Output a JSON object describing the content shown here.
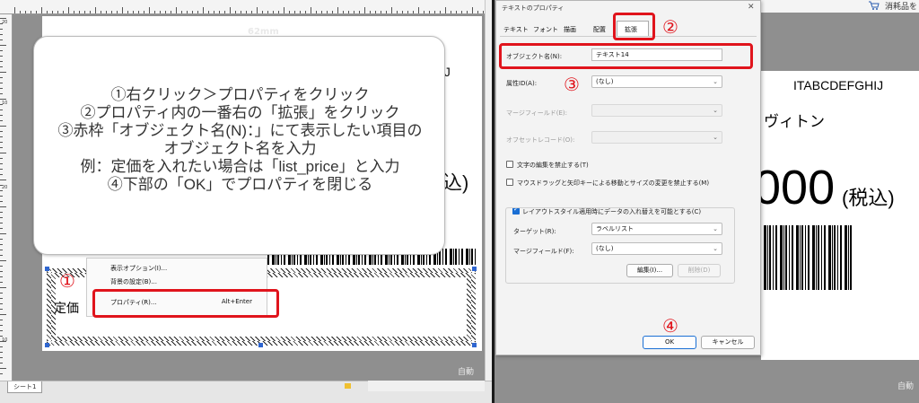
{
  "left_pane": {
    "ruler_numbers": [
      "20",
      "10",
      "20",
      "10"
    ],
    "label_size": "62mm",
    "bg_text": "GHIJ",
    "bg_tax": "込)",
    "price_label": "定価",
    "auto_label": "自動",
    "sheet_tab": "シート1"
  },
  "context_menu": {
    "items": [
      {
        "label": "表示オプション(I)..."
      },
      {
        "label": "背景の設定(B)..."
      },
      {
        "label": "プロパティ(R)...",
        "shortcut": "Alt+Enter"
      }
    ]
  },
  "callout": {
    "lines": [
      "①右クリック＞プロパティをクリック",
      "②プロパティ内の一番右の「拡張」をクリック",
      "③赤枠「オブジェクト名(N)：」にて表示したい項目の",
      "オブジェクト名を入力",
      "例：定価を入れたい場合は「list_price」と入力",
      "④下部の「OK」でプロパティを閉じる"
    ]
  },
  "steps": {
    "s1": "①",
    "s2": "②",
    "s3": "③",
    "s4": "④"
  },
  "dialog": {
    "title": "テキストのプロパティ",
    "close": "✕",
    "tabs": [
      "テキスト",
      "フォント",
      "描画",
      "配置",
      "拡張"
    ],
    "object_name_label": "オブジェクト名(N):",
    "object_name_value": "テキスト14",
    "attribute_label": "属性ID(A):",
    "attribute_value": "(なし)",
    "merge_field_label": "マージフィールド(E):",
    "offset_record_label": "オフセットレコード(O):",
    "chk_no_edit": "文字の編集を禁止する(T)",
    "chk_no_drag": "マウスドラッグと矢印キーによる移動とサイズの変更を禁止する(M)",
    "chk_layout": "レイアウトスタイル適用時にデータの入れ替えを可能とする(C)",
    "target_label": "ターゲット(R):",
    "target_value": "ラベルリスト",
    "merge_field2_label": "マージフィールド(F):",
    "merge_field2_value": "(なし)",
    "edit_btn": "編集(I)...",
    "delete_btn": "削除(D)",
    "ok_btn": "OK",
    "cancel_btn": "キャンセル"
  },
  "right_pane": {
    "top_text": "消耗品を",
    "bg_code": "ITABCDEFGHIJ",
    "brand": "ヴィトン",
    "price": "000",
    "tax": "(税込)",
    "auto_label": "自動"
  },
  "colors": {
    "highlight_red": "#e0141c",
    "accent_blue": "#1a6fd4"
  }
}
